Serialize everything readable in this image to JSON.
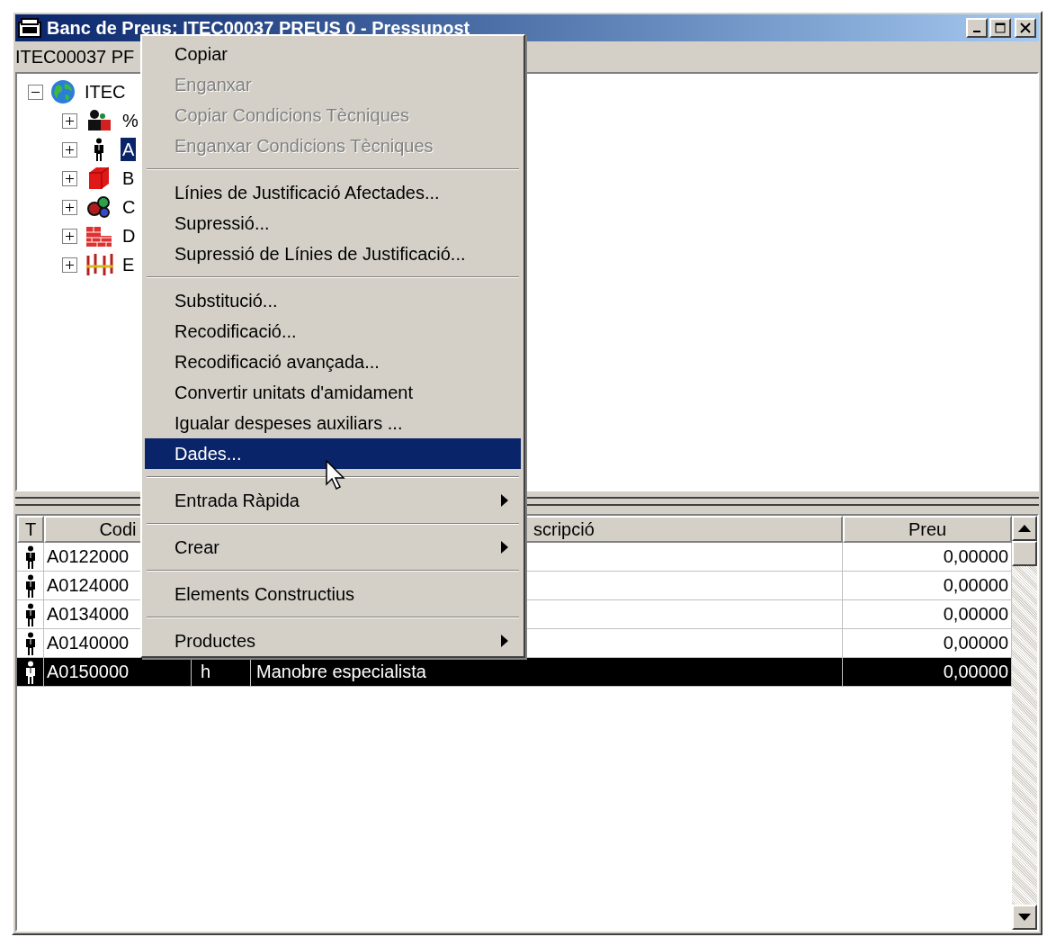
{
  "window": {
    "title": "Banc de Preus: ITEC00037 PREUS 0 - Pressupost"
  },
  "path_label": "ITEC00037 PF",
  "tree": {
    "root": {
      "label": "ITEC",
      "kind": "globe",
      "expanded": true,
      "selected": false,
      "children": [
        {
          "label": "%",
          "kind": "tools",
          "expanded": false,
          "selected": false
        },
        {
          "label": "A",
          "kind": "person",
          "expanded": false,
          "selected": true
        },
        {
          "label": "B",
          "kind": "block",
          "expanded": false,
          "selected": false
        },
        {
          "label": "C",
          "kind": "gears",
          "expanded": false,
          "selected": false
        },
        {
          "label": "D",
          "kind": "bricks",
          "expanded": false,
          "selected": false
        },
        {
          "label": "E",
          "kind": "frame",
          "expanded": false,
          "selected": false
        }
      ]
    }
  },
  "table": {
    "headers": {
      "t": "T",
      "codi": "Codi",
      "column_4": "scripció",
      "preu": "Preu"
    },
    "rows": [
      {
        "kind": "person",
        "code": "A0122000",
        "price": "0,00000",
        "selected": false
      },
      {
        "kind": "person",
        "code": "A0124000",
        "price": "0,00000",
        "selected": false
      },
      {
        "kind": "person",
        "code": "A0134000",
        "price": "0,00000",
        "selected": false
      },
      {
        "kind": "person",
        "code": "A0140000",
        "price": "0,00000",
        "selected": false
      },
      {
        "kind": "person",
        "code": "A0150000",
        "unit": "h",
        "description": "Manobre especialista",
        "price": "0,00000",
        "selected": true
      }
    ]
  },
  "context_menu": {
    "groups": [
      {
        "items": [
          {
            "label": "Copiar",
            "disabled": false,
            "selected": false,
            "submenu": false
          },
          {
            "label": "Enganxar",
            "disabled": true,
            "selected": false,
            "submenu": false
          },
          {
            "label": "Copiar Condicions Tècniques",
            "disabled": true,
            "selected": false,
            "submenu": false
          },
          {
            "label": "Enganxar Condicions Tècniques",
            "disabled": true,
            "selected": false,
            "submenu": false
          }
        ]
      },
      {
        "items": [
          {
            "label": "Línies de Justificació Afectades...",
            "disabled": false,
            "selected": false,
            "submenu": false
          },
          {
            "label": "Supressió...",
            "disabled": false,
            "selected": false,
            "submenu": false
          },
          {
            "label": "Supressió de Línies de Justificació...",
            "disabled": false,
            "selected": false,
            "submenu": false
          }
        ]
      },
      {
        "items": [
          {
            "label": "Substitució...",
            "disabled": false,
            "selected": false,
            "submenu": false
          },
          {
            "label": "Recodificació...",
            "disabled": false,
            "selected": false,
            "submenu": false
          },
          {
            "label": "Recodificació avançada...",
            "disabled": false,
            "selected": false,
            "submenu": false
          },
          {
            "label": "Convertir unitats d'amidament",
            "disabled": false,
            "selected": false,
            "submenu": false
          },
          {
            "label": "Igualar despeses auxiliars ...",
            "disabled": false,
            "selected": false,
            "submenu": false
          },
          {
            "label": "Dades...",
            "disabled": false,
            "selected": true,
            "submenu": false
          }
        ]
      },
      {
        "items": [
          {
            "label": "Entrada Ràpida",
            "disabled": false,
            "selected": false,
            "submenu": true
          }
        ]
      },
      {
        "items": [
          {
            "label": "Crear",
            "disabled": false,
            "selected": false,
            "submenu": true
          }
        ]
      },
      {
        "items": [
          {
            "label": "Elements Constructius",
            "disabled": false,
            "selected": false,
            "submenu": false
          }
        ]
      },
      {
        "items": [
          {
            "label": "Productes",
            "disabled": false,
            "selected": false,
            "submenu": true
          }
        ]
      }
    ]
  }
}
